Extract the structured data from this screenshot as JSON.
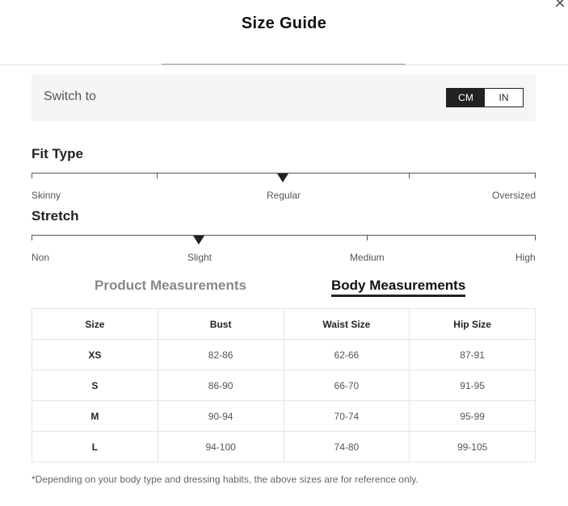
{
  "header": {
    "title": "Size Guide",
    "close_icon": "close-icon"
  },
  "unit_switch": {
    "label": "Switch to",
    "options": [
      "CM",
      "IN"
    ],
    "selected": "CM"
  },
  "fit_type": {
    "title": "Fit Type",
    "labels": [
      "Skinny",
      "Regular",
      "Oversized"
    ],
    "selected": "Regular"
  },
  "stretch": {
    "title": "Stretch",
    "labels": [
      "Non",
      "Slight",
      "Medium",
      "High"
    ],
    "selected": "Slight"
  },
  "tabs": [
    {
      "label": "Product Measurements",
      "active": false
    },
    {
      "label": "Body Measurements",
      "active": true
    }
  ],
  "table": {
    "headers": [
      "Size",
      "Bust",
      "Waist Size",
      "Hip Size"
    ],
    "rows": [
      [
        "XS",
        "82-86",
        "62-66",
        "87-91"
      ],
      [
        "S",
        "86-90",
        "66-70",
        "91-95"
      ],
      [
        "M",
        "90-94",
        "70-74",
        "95-99"
      ],
      [
        "L",
        "94-100",
        "74-80",
        "99-105"
      ]
    ]
  },
  "footnote": "*Depending on your body type and dressing habits, the above sizes are for reference only."
}
